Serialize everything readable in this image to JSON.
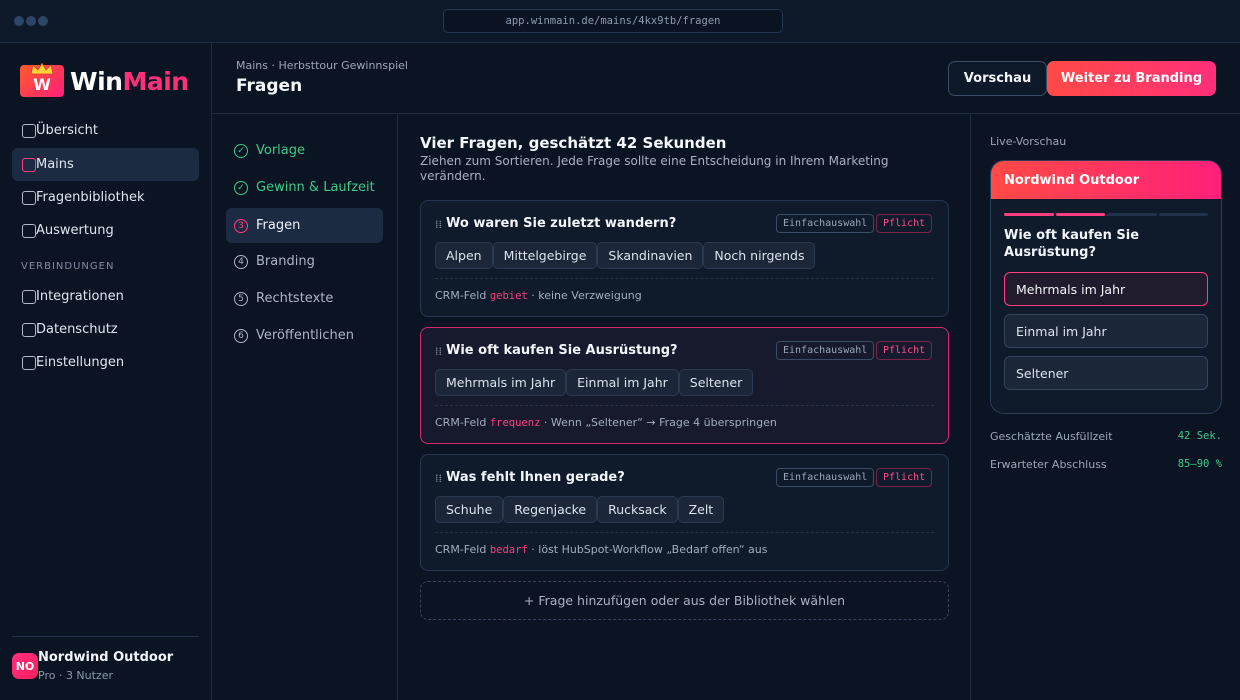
{
  "browser": {
    "url": "app.winmain.de/mains/4kx9tb/fragen"
  },
  "brand": {
    "mark_letter": "W",
    "name_a": "Win",
    "name_b": "Main"
  },
  "sidebar": {
    "items": [
      {
        "label": "Übersicht"
      },
      {
        "label": "Mains"
      },
      {
        "label": "Fragenbibliothek"
      },
      {
        "label": "Auswertung"
      }
    ],
    "section_label": "VERBINDUNGEN",
    "items2": [
      {
        "label": "Integrationen"
      },
      {
        "label": "Datenschutz"
      },
      {
        "label": "Einstellungen"
      }
    ],
    "account": {
      "initials": "NO",
      "name": "Nordwind Outdoor",
      "plan": "Pro · 3 Nutzer"
    }
  },
  "header": {
    "breadcrumb": "Mains · Herbsttour Gewinnspiel",
    "title": "Fragen",
    "preview_label": "Vorschau",
    "next_label": "Weiter zu Branding"
  },
  "steps": [
    {
      "icon": "✓",
      "label": "Vorlage"
    },
    {
      "icon": "✓",
      "label": "Gewinn & Laufzeit"
    },
    {
      "icon": "3",
      "label": "Fragen"
    },
    {
      "icon": "4",
      "label": "Branding"
    },
    {
      "icon": "5",
      "label": "Rechtstexte"
    },
    {
      "icon": "6",
      "label": "Veröffentlichen"
    }
  ],
  "main": {
    "title": "Vier Fragen, geschätzt 42 Sekunden",
    "subtitle": "Ziehen zum Sortieren. Jede Frage sollte eine Entscheidung in Ihrem Marketing verändern.",
    "questions": [
      {
        "title": "Wo waren Sie zuletzt wandern?",
        "type": "Einfachauswahl",
        "required": "Pflicht",
        "options": [
          "Alpen",
          "Mittelgebirge",
          "Skandinavien",
          "Noch nirgends"
        ],
        "meta_prefix": "CRM-Feld",
        "field": "gebiet",
        "meta_suffix": "· keine Verzweigung"
      },
      {
        "title": "Wie oft kaufen Sie Ausrüstung?",
        "type": "Einfachauswahl",
        "required": "Pflicht",
        "options": [
          "Mehrmals im Jahr",
          "Einmal im Jahr",
          "Seltener"
        ],
        "meta_prefix": "CRM-Feld",
        "field": "frequenz",
        "meta_suffix": "· Wenn „Seltener“ → Frage 4 überspringen"
      },
      {
        "title": "Was fehlt Ihnen gerade?",
        "type": "Einfachauswahl",
        "required": "Pflicht",
        "options": [
          "Schuhe",
          "Regenjacke",
          "Rucksack",
          "Zelt"
        ],
        "meta_prefix": "CRM-Feld",
        "field": "bedarf",
        "meta_suffix": "· löst HubSpot-Workflow „Bedarf offen“ aus"
      }
    ],
    "add_label": "+ Frage hinzufügen oder aus der Bibliothek wählen"
  },
  "preview": {
    "label": "Live-Vorschau",
    "brand": "Nordwind Outdoor",
    "progress_segments_done": 2,
    "progress_segments_total": 4,
    "question": "Wie oft kaufen Sie Ausrüstung?",
    "answers": [
      "Mehrmals im Jahr",
      "Einmal im Jahr",
      "Seltener"
    ],
    "stats": [
      {
        "label": "Geschätzte Ausfüllzeit",
        "value": "42 Sek."
      },
      {
        "label": "Erwarteter Abschluss",
        "value": "85–90 %"
      }
    ]
  },
  "colors": {
    "accent": "#ff2f7a",
    "accent_orange": "#ff4a46",
    "success": "#3ec98a",
    "bg": "#0b1422"
  }
}
